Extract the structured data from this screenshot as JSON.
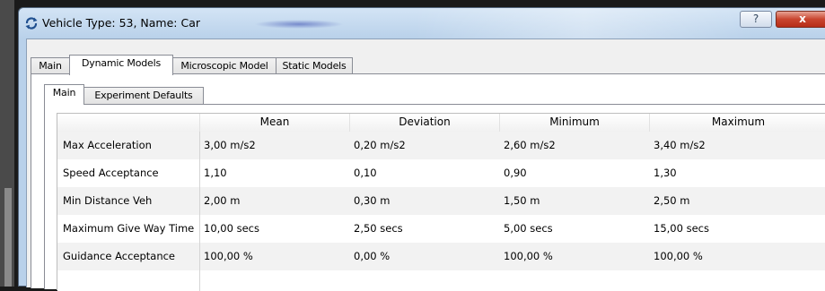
{
  "window": {
    "title": "Vehicle Type: 53, Name: Car",
    "help_label": "?",
    "close_label": "x"
  },
  "outer_tabs": [
    {
      "label": "Main",
      "active": false
    },
    {
      "label": "Dynamic Models",
      "active": true
    },
    {
      "label": "Microscopic Model",
      "active": false
    },
    {
      "label": "Static Models",
      "active": false
    }
  ],
  "inner_tabs": [
    {
      "label": "Main",
      "active": true
    },
    {
      "label": "Experiment Defaults",
      "active": false
    }
  ],
  "table": {
    "columns": [
      "",
      "Mean",
      "Deviation",
      "Minimum",
      "Maximum"
    ],
    "rows": [
      {
        "label": "Max Acceleration",
        "mean": "3,00 m/s2",
        "deviation": "0,20 m/s2",
        "minimum": "2,60 m/s2",
        "maximum": "3,40 m/s2"
      },
      {
        "label": "Speed Acceptance",
        "mean": "1,10",
        "deviation": "0,10",
        "minimum": "0,90",
        "maximum": "1,30"
      },
      {
        "label": "Min Distance Veh",
        "mean": "2,00 m",
        "deviation": "0,30 m",
        "minimum": "1,50 m",
        "maximum": "2,50 m"
      },
      {
        "label": "Maximum Give Way Time",
        "mean": "10,00 secs",
        "deviation": "2,50 secs",
        "minimum": "5,00 secs",
        "maximum": "15,00 secs"
      },
      {
        "label": "Guidance Acceptance",
        "mean": "100,00 %",
        "deviation": "0,00 %",
        "minimum": "100,00 %",
        "maximum": "100,00 %"
      },
      {
        "label": "",
        "mean": "",
        "deviation": "",
        "minimum": "",
        "maximum": ""
      }
    ]
  },
  "icons": {
    "app": "refresh-cycle-icon",
    "help": "help-icon",
    "close": "close-icon"
  },
  "colors": {
    "titlebar": "#b9d1ea",
    "close_button": "#c9452f",
    "row_alt": "#f2f2f2"
  }
}
